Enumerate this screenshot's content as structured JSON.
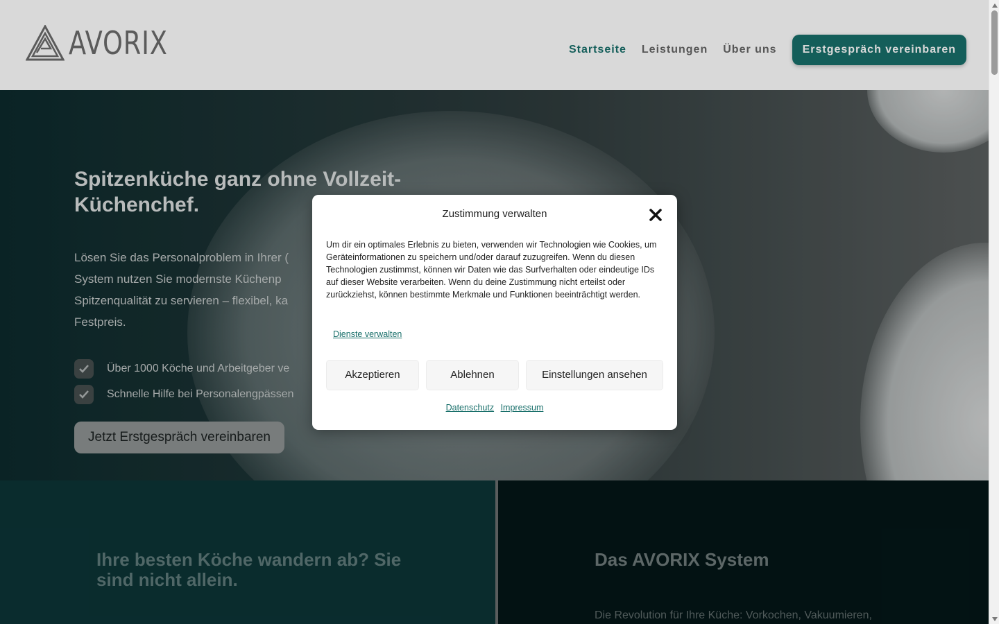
{
  "header": {
    "logo_text": "AVORIX",
    "nav": [
      "Startseite",
      "Leistungen",
      "Über uns"
    ],
    "cta": "Erstgespräch vereinbaren"
  },
  "hero": {
    "title": "Spitzenküche ganz ohne Vollzeit-Küchenchef.",
    "text": "Lösen Sie das Personalproblem in Ihrer ( System nutzen Sie modernste Küchenp Spitzenqualität zu servieren – flexibel, ka Festpreis.",
    "checks": [
      "Über 1000 Köche und Arbeitgeber ve",
      "Schnelle Hilfe bei Personalengpässen"
    ],
    "button": "Jetzt Erstgespräch vereinbaren"
  },
  "sections": {
    "left_title": "Ihre besten Köche wandern ab? Sie sind nicht allein.",
    "right_title": "Das AVORIX System",
    "right_text": "Die Revolution für Ihre Küche: Vorkochen, Vakuumieren,"
  },
  "consent": {
    "title": "Zustimmung verwalten",
    "text": "Um dir ein optimales Erlebnis zu bieten, verwenden wir Technologien wie Cookies, um Geräteinformationen zu speichern und/oder darauf zuzugreifen. Wenn du diesen Technologien zustimmst, können wir Daten wie das Surfverhalten oder eindeutige IDs auf dieser Website verarbeiten. Wenn du deine Zustimmung nicht erteilst oder zurückziehst, können bestimmte Merkmale und Funktionen beeinträchtigt werden.",
    "manage_link": "Dienste verwalten",
    "accept": "Akzeptieren",
    "deny": "Ablehnen",
    "settings": "Einstellungen ansehen",
    "privacy": "Datenschutz",
    "imprint": "Impressum"
  },
  "colors": {
    "accent": "#186f6a",
    "modal_bg": "#ffffff",
    "button_bg": "#f6f6f6"
  },
  "icons": {
    "close": "close-icon",
    "check": "check-icon",
    "logo": "logo-icon"
  }
}
